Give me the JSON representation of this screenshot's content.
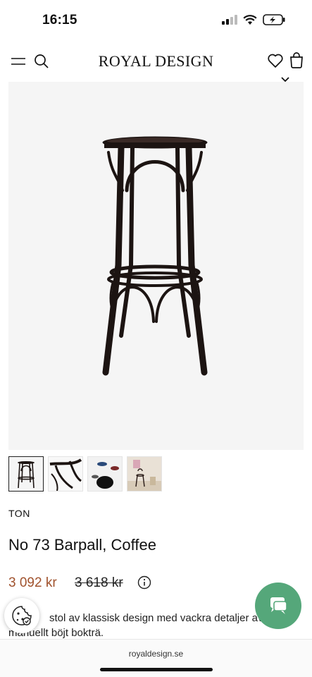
{
  "status_bar": {
    "time": "16:15"
  },
  "header": {
    "logo": "ROYAL DESIGN"
  },
  "product": {
    "brand": "TON",
    "title": "No 73 Barpall, Coffee",
    "price": "3 092 kr",
    "old_price": "3 618 kr",
    "description_line1": "stol av klassisk design med vackra detaljer av",
    "description_line2": "manuellt böjt bokträ."
  },
  "thumbnails": [
    {
      "name": "thumb-front",
      "active": true
    },
    {
      "name": "thumb-detail",
      "active": false
    },
    {
      "name": "thumb-top",
      "active": false
    },
    {
      "name": "thumb-room",
      "active": false
    }
  ],
  "browser": {
    "url": "royaldesign.se"
  },
  "colors": {
    "price": "#a0522d",
    "chat_button": "#55a77a",
    "image_bg": "#f5f5f5"
  },
  "icons": [
    "menu-icon",
    "search-icon",
    "heart-icon",
    "bag-icon",
    "info-icon",
    "cookie-icon",
    "chat-icon",
    "chevron-down-icon"
  ]
}
